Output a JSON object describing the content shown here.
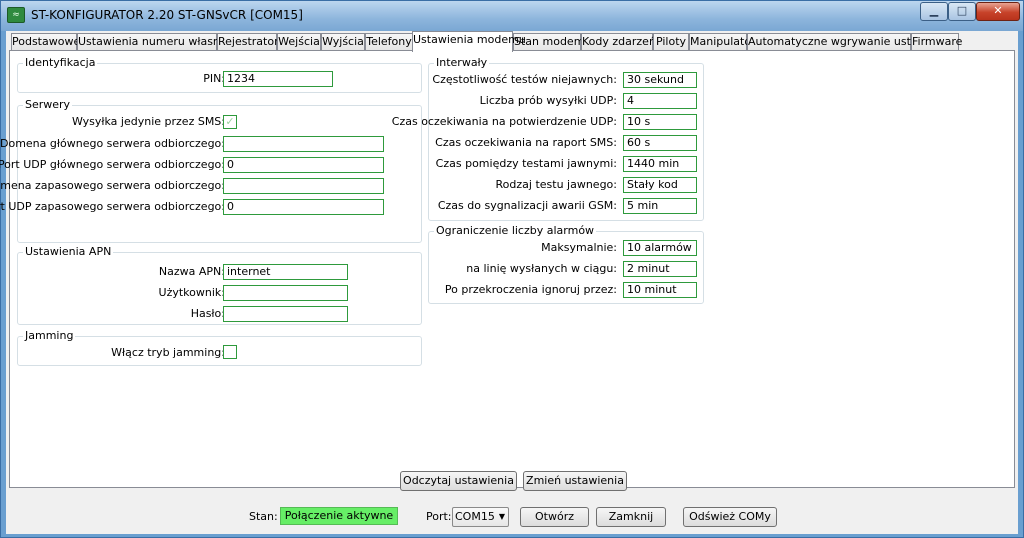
{
  "window": {
    "title": "ST-KONFIGURATOR 2.20 ST-GNSvCR   [COM15]",
    "icon": "app-icon",
    "controls": {
      "minimize": "minimize-icon",
      "maximize": "maximize-icon",
      "close": "close-icon"
    }
  },
  "tabs": [
    {
      "label": "Podstawowe"
    },
    {
      "label": "Ustawienia numeru własnego"
    },
    {
      "label": "Rejestrator"
    },
    {
      "label": "Wejścia"
    },
    {
      "label": "Wyjścia"
    },
    {
      "label": "Telefony"
    },
    {
      "label": "Ustawienia modemu",
      "active": true
    },
    {
      "label": "Stan modemu"
    },
    {
      "label": "Kody zdarzeń"
    },
    {
      "label": "Piloty"
    },
    {
      "label": "Manipulator"
    },
    {
      "label": "Automatyczne wgrywanie ustawień"
    },
    {
      "label": "Firmware"
    }
  ],
  "identyfikacja": {
    "title": "Identyfikacja",
    "pin_label": "PIN:",
    "pin_value": "1234"
  },
  "serwery": {
    "title": "Serwery",
    "sms_only_label": "Wysyłka jedynie przez SMS:",
    "sms_only_checked": true,
    "main_domain_label": "Domena głównego serwera odbiorczego:",
    "main_domain_value": "",
    "main_port_label": "Port UDP głównego serwera odbiorczego:",
    "main_port_value": "0",
    "backup_domain_label": "Domena zapasowego serwera odbiorczego:",
    "backup_domain_value": "",
    "backup_port_label": "Port UDP zapasowego serwera odbiorczego:",
    "backup_port_value": "0"
  },
  "apn": {
    "title": "Ustawienia APN",
    "name_label": "Nazwa APN:",
    "name_value": "internet",
    "user_label": "Użytkownik:",
    "user_value": "",
    "password_label": "Hasło:",
    "password_value": ""
  },
  "jamming": {
    "title": "Jamming",
    "enable_label": "Włącz tryb jamming:",
    "enable_checked": false
  },
  "interwaly": {
    "title": "Interwały",
    "rows": [
      {
        "label": "Częstotliwość testów niejawnych:",
        "value": "30 sekund"
      },
      {
        "label": "Liczba prób wysyłki UDP:",
        "value": "4"
      },
      {
        "label": "Czas oczekiwania na potwierdzenie UDP:",
        "value": "10 s"
      },
      {
        "label": "Czas oczekiwania na raport SMS:",
        "value": "60 s"
      },
      {
        "label": "Czas pomiędzy testami jawnymi:",
        "value": "1440 min"
      },
      {
        "label": "Rodzaj testu jawnego:",
        "value": "Stały kod"
      },
      {
        "label": "Czas do sygnalizacji awarii GSM:",
        "value": "5 min"
      }
    ]
  },
  "ograniczenie": {
    "title": "Ograniczenie liczby alarmów",
    "rows": [
      {
        "label": "Maksymalnie:",
        "value": "10 alarmów"
      },
      {
        "label": "na linię wysłanych w ciągu:",
        "value": "2 minut"
      },
      {
        "label": "Po przekroczenia ignoruj przez:",
        "value": "10 minut"
      }
    ]
  },
  "actions": {
    "read_label": "Odczytaj ustawienia",
    "write_label": "Zmień ustawienia"
  },
  "status": {
    "state_label": "Stan:",
    "state_value": "Połączenie aktywne",
    "state_color": "#66ee66",
    "port_label": "Port:",
    "port_value": "COM15",
    "open_label": "Otwórz",
    "close_label": "Zamknij",
    "refresh_label": "Odśwież COMy"
  }
}
